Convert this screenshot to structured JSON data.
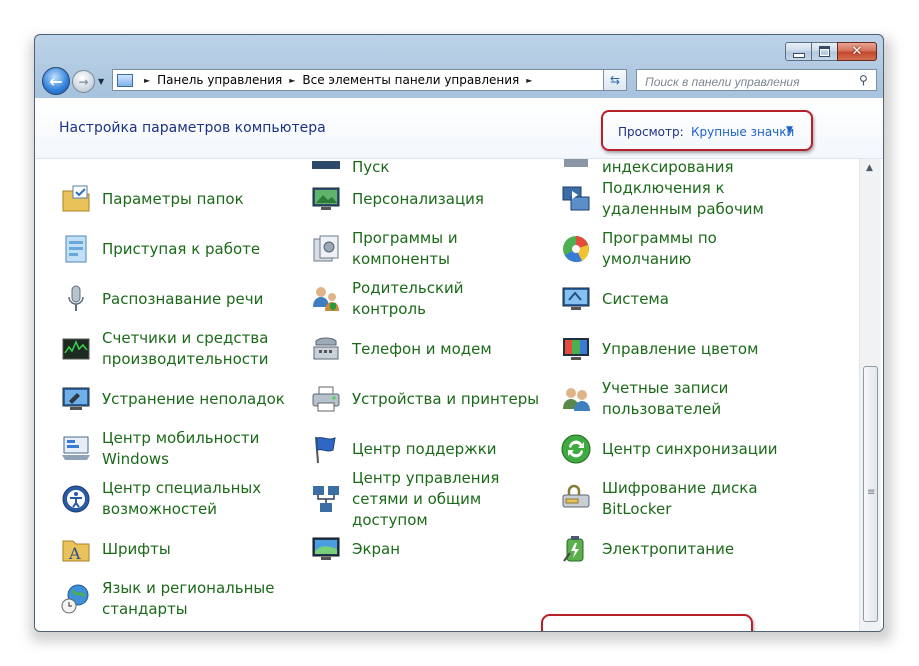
{
  "address": {
    "segments": [
      "Панель управления",
      "Все элементы панели управления"
    ]
  },
  "search": {
    "placeholder": "Поиск в панели управления"
  },
  "header": {
    "title": "Настройка параметров компьютера",
    "view_label": "Просмотр:",
    "view_value": "Крупные значки"
  },
  "partial_row": [
    "Пуск",
    "индексирования"
  ],
  "columns": [
    [
      {
        "label": "Параметры папок",
        "icon": "folder-options-icon"
      },
      {
        "label": "Приступая к работе",
        "icon": "getting-started-icon"
      },
      {
        "label": "Распознавание речи",
        "icon": "microphone-icon"
      },
      {
        "label": "Счетчики и средства производительности",
        "icon": "performance-icon"
      },
      {
        "label": "Устранение неполадок",
        "icon": "troubleshooting-icon"
      },
      {
        "label": "Центр мобильности Windows",
        "icon": "mobility-center-icon"
      },
      {
        "label": "Центр специальных возможностей",
        "icon": "ease-of-access-icon"
      },
      {
        "label": "Шрифты",
        "icon": "fonts-folder-icon"
      },
      {
        "label": "Язык и региональные стандарты",
        "icon": "globe-clock-icon"
      }
    ],
    [
      {
        "label": "Персонализация",
        "icon": "personalization-icon"
      },
      {
        "label": "Программы и компоненты",
        "icon": "programs-icon"
      },
      {
        "label": "Родительский контроль",
        "icon": "parental-controls-icon"
      },
      {
        "label": "Телефон и модем",
        "icon": "phone-modem-icon"
      },
      {
        "label": "Устройства и принтеры",
        "icon": "printer-icon"
      },
      {
        "label": "Центр поддержки",
        "icon": "flag-icon"
      },
      {
        "label": "Центр управления сетями и общим доступом",
        "icon": "network-icon"
      },
      {
        "label": "Экран",
        "icon": "display-icon"
      }
    ],
    [
      {
        "label": "Подключения к удаленным рабочим",
        "icon": "remote-desktop-icon"
      },
      {
        "label": "Программы по умолчанию",
        "icon": "default-programs-icon"
      },
      {
        "label": "Система",
        "icon": "system-icon"
      },
      {
        "label": "Управление цветом",
        "icon": "color-management-icon"
      },
      {
        "label": "Учетные записи пользователей",
        "icon": "user-accounts-icon"
      },
      {
        "label": "Центр синхронизации",
        "icon": "sync-center-icon"
      },
      {
        "label": "Шифрование диска BitLocker",
        "icon": "bitlocker-icon"
      },
      {
        "label": "Электропитание",
        "icon": "power-options-icon"
      }
    ]
  ]
}
